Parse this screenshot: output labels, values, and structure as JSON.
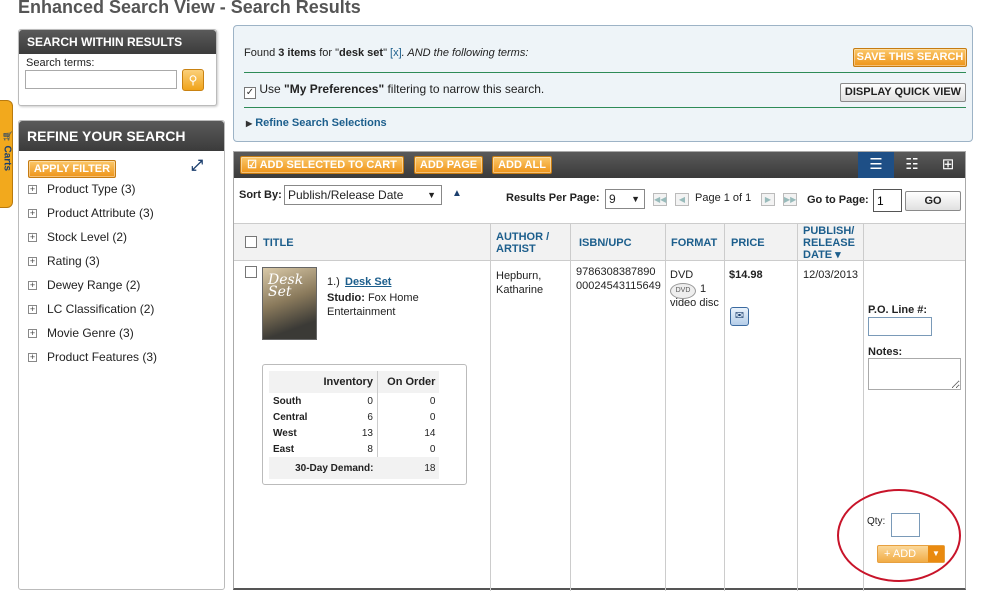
{
  "page": {
    "title": "Enhanced Search View - Search Results"
  },
  "carts_tab": {
    "label": "Carts"
  },
  "search_within": {
    "header": "SEARCH WITHIN RESULTS",
    "terms_label": "Search terms:",
    "terms_value": "",
    "go_icon": "search-icon"
  },
  "refine": {
    "header": "REFINE YOUR SEARCH",
    "apply_label": "APPLY FILTER",
    "facets": [
      {
        "label": "Product Type (3)"
      },
      {
        "label": "Product Attribute (3)"
      },
      {
        "label": "Stock Level (2)"
      },
      {
        "label": "Rating (3)"
      },
      {
        "label": "Dewey Range (2)"
      },
      {
        "label": "LC Classification (2)"
      },
      {
        "label": "Movie Genre (3)"
      },
      {
        "label": "Product Features (3)"
      }
    ]
  },
  "info": {
    "found_prefix": "Found ",
    "found_count": "3 items",
    "found_mid": " for \"",
    "query": "desk set",
    "found_mid2": "\" ",
    "remove": "[x]",
    "found_suffix": ". AND the following terms:",
    "save_label": "SAVE THIS SEARCH",
    "pref_prefix": "Use ",
    "pref_bold": "\"My Preferences\"",
    "pref_suffix": " filtering to narrow this search.",
    "pref_checked": true,
    "quick_view_label": "DISPLAY QUICK VIEW",
    "refine_link": "Refine Search Selections"
  },
  "results_bar": {
    "add_selected": "ADD SELECTED TO CART",
    "add_page": "ADD PAGE",
    "add_all": "ADD ALL",
    "view_icons": [
      "list-view-icon",
      "detail-view-icon",
      "grid-view-icon"
    ]
  },
  "controls": {
    "sort_label": "Sort By:",
    "sort_value": "Publish/Release Date",
    "rpp_label": "Results Per Page:",
    "rpp_value": "9",
    "page_label": "Page 1 of 1",
    "goto_label": "Go to Page:",
    "goto_value": "1",
    "go_label": "GO"
  },
  "columns": [
    "TITLE",
    "AUTHOR / ARTIST",
    "ISBN/UPC",
    "FORMAT",
    "PRICE",
    "PUBLISH/ RELEASE DATE ▾"
  ],
  "item": {
    "number": "1.)",
    "title": "Desk Set",
    "studio_label": "Studio:",
    "studio_value": "Fox Home Entertainment",
    "cover_text": "Desk Set",
    "author": "Hepburn, Katharine",
    "isbn": "9786308387890",
    "upc": "00024543115649",
    "format": "DVD",
    "format_icon_text": "DVD",
    "format_count": "1",
    "format_desc": "video disc",
    "price": "$14.98",
    "pub_date": "12/03/2013",
    "po_label": "P.O. Line #:",
    "notes_label": "Notes:",
    "qty_label": "Qty:",
    "add_label": "+ ADD"
  },
  "inventory": {
    "headers": [
      "Inventory",
      "On Order"
    ],
    "rows": [
      {
        "region": "South",
        "inventory": "0",
        "on_order": "0"
      },
      {
        "region": "Central",
        "inventory": "6",
        "on_order": "0"
      },
      {
        "region": "West",
        "inventory": "13",
        "on_order": "14"
      },
      {
        "region": "East",
        "inventory": "8",
        "on_order": "0"
      }
    ],
    "demand_label": "30-Day Demand:",
    "demand_value": "18"
  },
  "colors": {
    "accent_orange": "#f0a31a",
    "link_blue": "#1c5e8c",
    "header_dark": "#3b3b3b",
    "highlight_red": "#c8142a"
  }
}
